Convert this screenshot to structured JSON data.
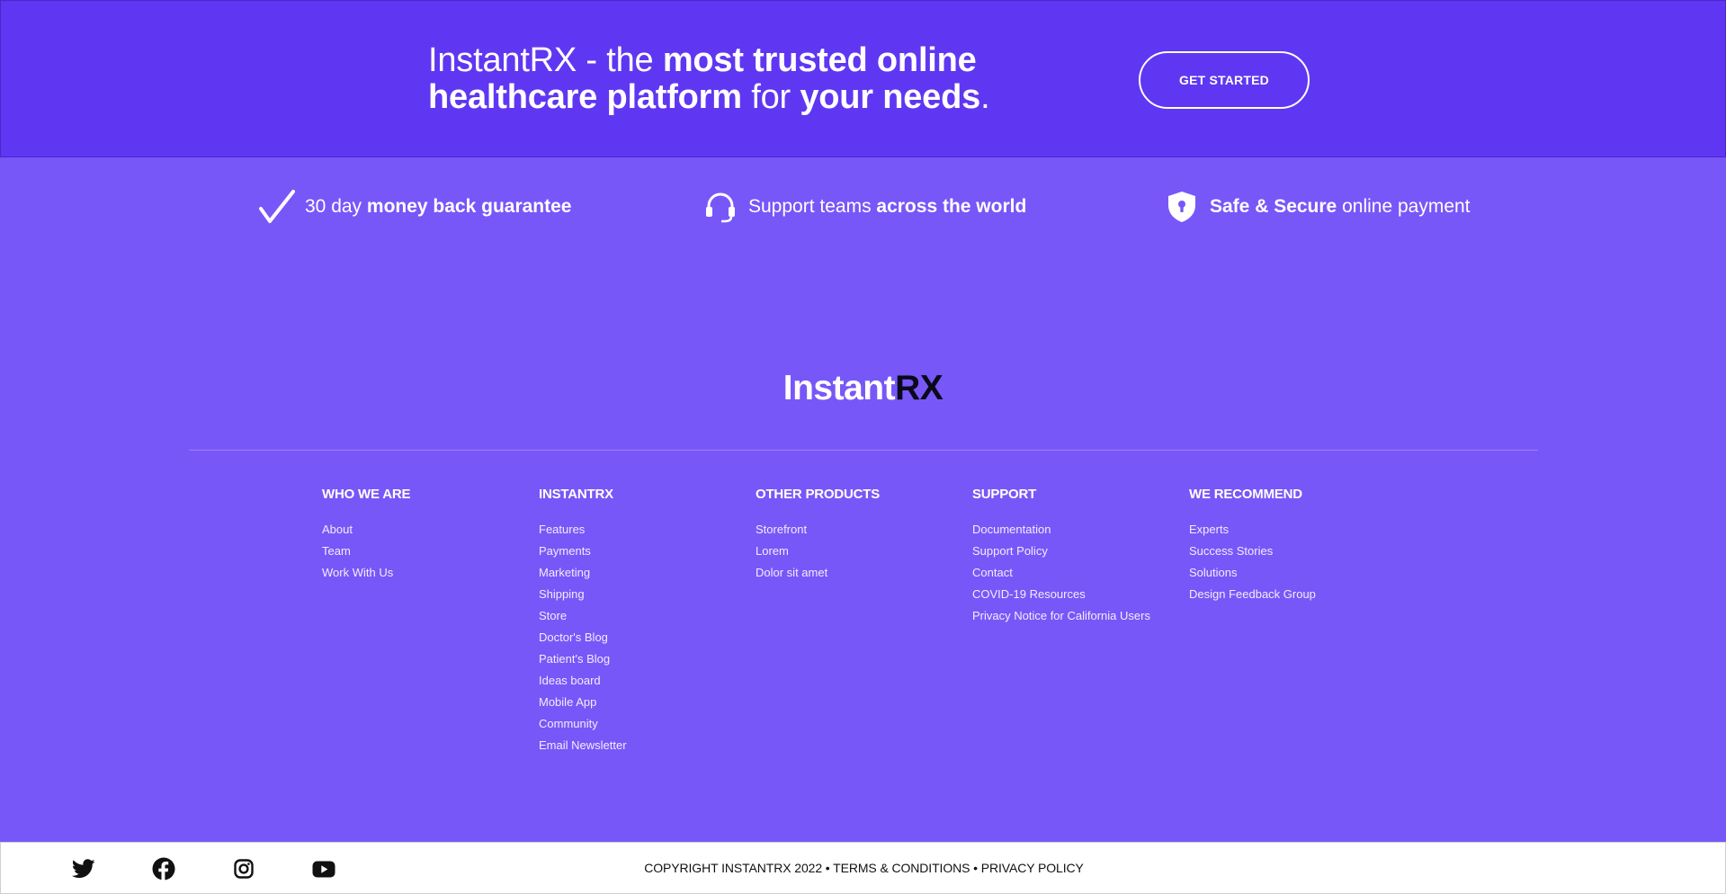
{
  "hero": {
    "p1": "InstantRX - the ",
    "p2": "most trusted online healthcare platform",
    "p3": " for ",
    "p4": "your needs",
    "p5": ".",
    "cta": "GET STARTED"
  },
  "features": [
    {
      "icon": "checkmark-icon",
      "pre": "30 day ",
      "bold": "money back guarantee",
      "post": ""
    },
    {
      "icon": "headset-icon",
      "pre": "Support teams ",
      "bold": "across the world",
      "post": ""
    },
    {
      "icon": "shield-lock-icon",
      "pre": "",
      "bold": "Safe & Secure",
      "post": " online payment"
    }
  ],
  "logo": {
    "a": "Instant",
    "b": "RX"
  },
  "columns": [
    {
      "title": "WHO WE ARE",
      "links": [
        "About",
        "Team",
        "Work With Us"
      ]
    },
    {
      "title": "INSTANTRX",
      "links": [
        "Features",
        "Payments",
        "Marketing",
        "Shipping",
        "Store",
        "Doctor's Blog",
        "Patient's Blog",
        "Ideas board",
        "Mobile App",
        "Community",
        "Email Newsletter"
      ]
    },
    {
      "title": "OTHER PRODUCTS",
      "links": [
        "Storefront",
        "Lorem",
        "Dolor sit amet"
      ]
    },
    {
      "title": "SUPPORT",
      "links": [
        "Documentation",
        "Support Policy",
        "Contact",
        "COVID-19 Resources",
        "Privacy Notice for California Users"
      ]
    },
    {
      "title": "WE RECOMMEND",
      "links": [
        "Experts",
        "Success Stories",
        "Solutions",
        "Design Feedback Group"
      ]
    }
  ],
  "footer": {
    "social": [
      "twitter-icon",
      "facebook-icon",
      "instagram-icon",
      "youtube-icon"
    ],
    "copyright": "COPYRIGHT INSTANTRX 2022",
    "sep": " • ",
    "terms": "TERMS & CONDITIONS",
    "privacy": "PRIVACY POLICY"
  },
  "colors": {
    "hero_bg": "#5f37f2",
    "page_bg": "#7857f8",
    "accent_dark": "#0a0a1a"
  }
}
